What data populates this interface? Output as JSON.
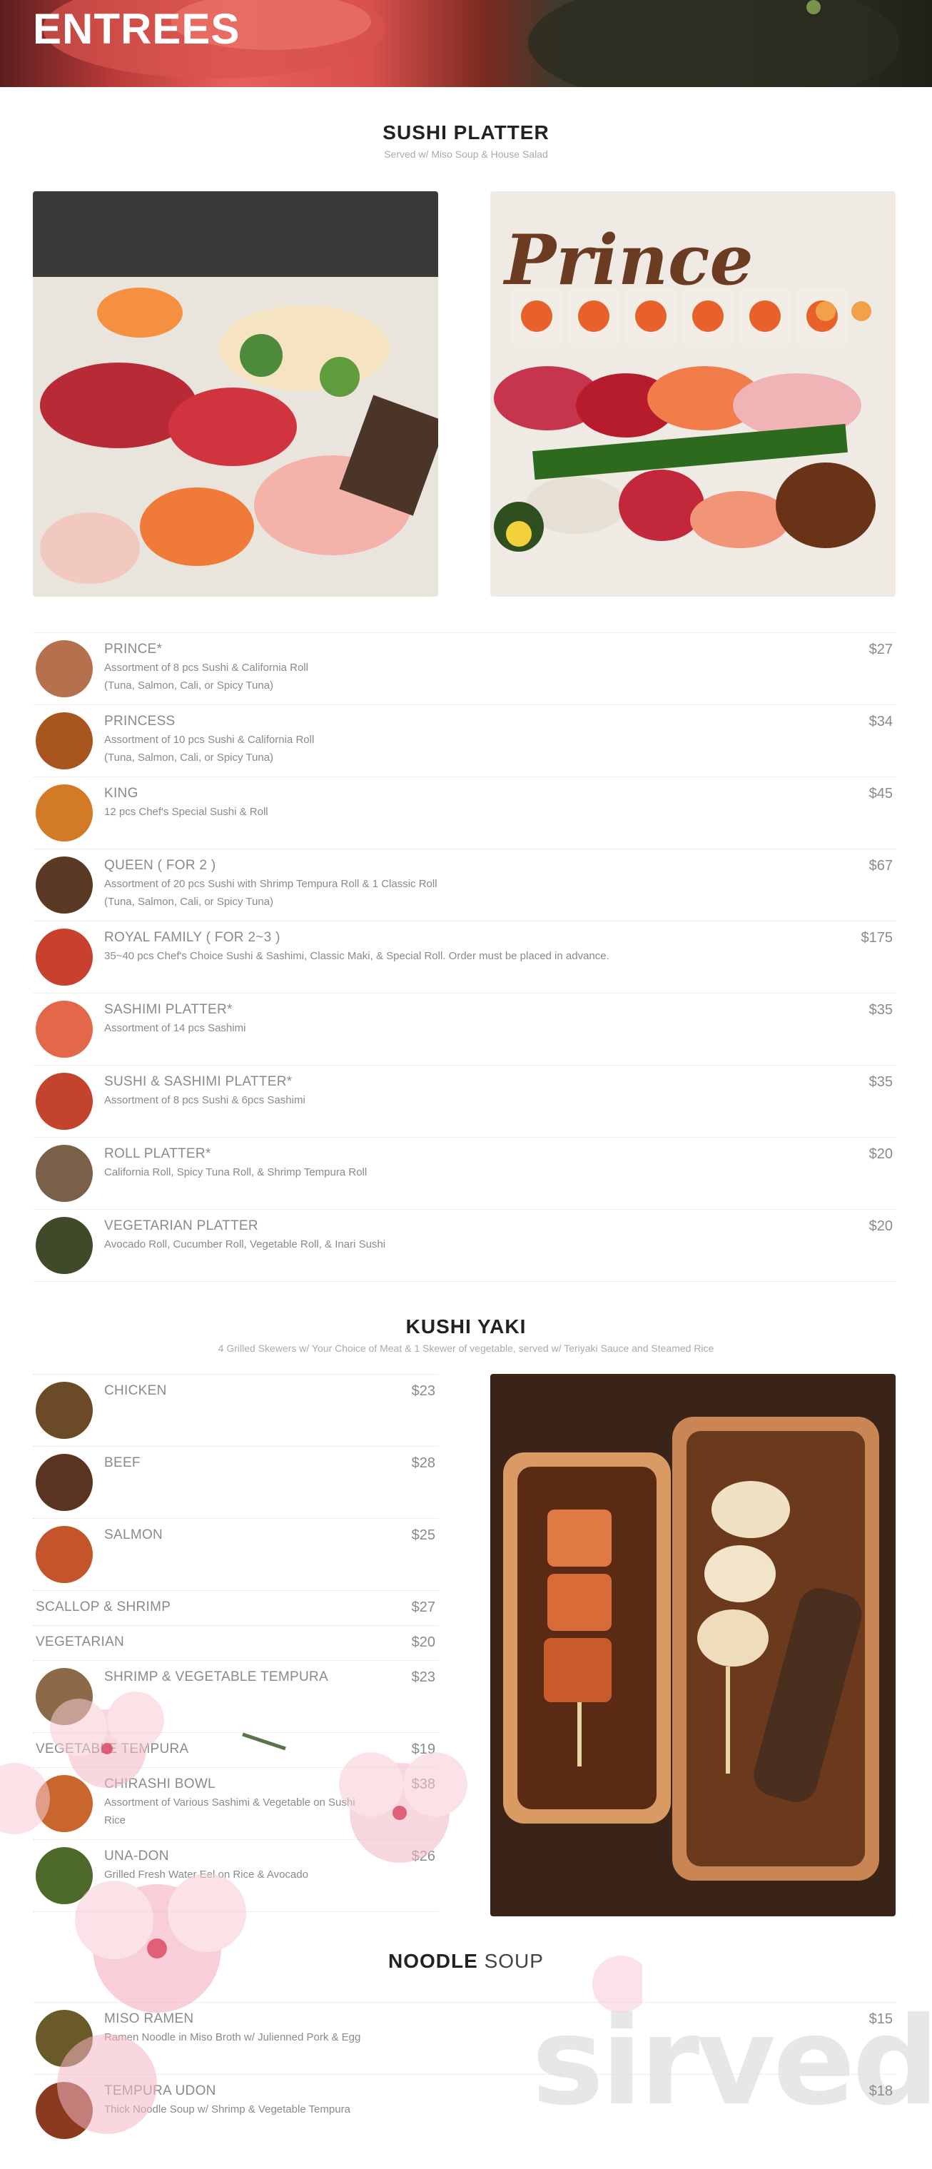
{
  "header": {
    "title": "ENTREES"
  },
  "sushi": {
    "title": "SUSHI PLATTER",
    "subtitle": "Served w/ Miso Soup & House Salad",
    "photo_right_text": "Prince",
    "items": [
      {
        "name": "PRINCE*",
        "desc1": "Assortment of 8 pcs Sushi & California Roll",
        "desc2": "(Tuna, Salmon, Cali, or Spicy Tuna)",
        "price": "$27"
      },
      {
        "name": "PRINCESS",
        "desc1": "Assortment of 10 pcs Sushi & California Roll",
        "desc2": "(Tuna, Salmon, Cali, or Spicy Tuna)",
        "price": "$34"
      },
      {
        "name": "KING",
        "desc1": "12 pcs Chef's Special Sushi & Roll",
        "desc2": "",
        "price": "$45"
      },
      {
        "name": "QUEEN ( FOR 2 )",
        "desc1": "Assortment of 20 pcs Sushi with Shrimp Tempura Roll & 1 Classic Roll",
        "desc2": "(Tuna, Salmon, Cali, or Spicy Tuna)",
        "price": "$67"
      },
      {
        "name": "ROYAL FAMILY ( FOR 2~3 )",
        "desc1": "35~40 pcs Chef's Choice Sushi & Sashimi, Classic Maki, & Special Roll. Order must be placed in advance.",
        "desc2": "",
        "price": "$175"
      },
      {
        "name": "SASHIMI PLATTER*",
        "desc1": "Assortment of 14 pcs Sashimi",
        "desc2": "",
        "price": "$35"
      },
      {
        "name": "SUSHI & SASHIMI PLATTER*",
        "desc1": "Assortment of 8 pcs Sushi & 6pcs Sashimi",
        "desc2": "",
        "price": "$35"
      },
      {
        "name": "ROLL PLATTER*",
        "desc1": "California Roll, Spicy Tuna Roll, & Shrimp Tempura Roll",
        "desc2": "",
        "price": "$20"
      },
      {
        "name": "VEGETARIAN PLATTER",
        "desc1": "Avocado Roll, Cucumber Roll, Vegetable Roll, & Inari Sushi",
        "desc2": "",
        "price": "$20"
      }
    ]
  },
  "kushi": {
    "title": "KUSHI YAKI",
    "subtitle": "4 Grilled Skewers w/ Your Choice of Meat & 1 Skewer of vegetable, served w/ Teriyaki Sauce and Steamed Rice",
    "items": [
      {
        "name": "CHICKEN",
        "desc1": "",
        "price": "$23"
      },
      {
        "name": "BEEF",
        "desc1": "",
        "price": "$28"
      },
      {
        "name": "SALMON",
        "desc1": "",
        "price": "$25"
      },
      {
        "name": "SCALLOP & SHRIMP",
        "desc1": "",
        "price": "$27"
      },
      {
        "name": "VEGETARIAN",
        "desc1": "",
        "price": "$20"
      },
      {
        "name": "SHRIMP & VEGETABLE TEMPURA",
        "desc1": "",
        "price": "$23"
      },
      {
        "name": "VEGETABLE TEMPURA",
        "desc1": "",
        "price": "$19"
      },
      {
        "name": "CHIRASHI BOWL",
        "desc1": "Assortment of Various Sashimi & Vegetable on Sushi",
        "desc2": "Rice",
        "price": "$38"
      },
      {
        "name": "UNA-DON",
        "desc1": "Grilled Fresh Water Eel on Rice & Avocado",
        "desc2": "",
        "price": "$26"
      }
    ]
  },
  "noodle": {
    "title_bold": "NOODLE",
    "title_light": " SOUP",
    "items": [
      {
        "name": "MISO RAMEN",
        "desc1": "Ramen Noodle in Miso Broth w/ Julienned Pork & Egg",
        "price": "$15"
      },
      {
        "name": "TEMPURA UDON",
        "desc1": "Thick Noodle Soup w/ Shrimp & Vegetable Tempura",
        "price": "$18"
      }
    ]
  },
  "watermark": "sirved"
}
